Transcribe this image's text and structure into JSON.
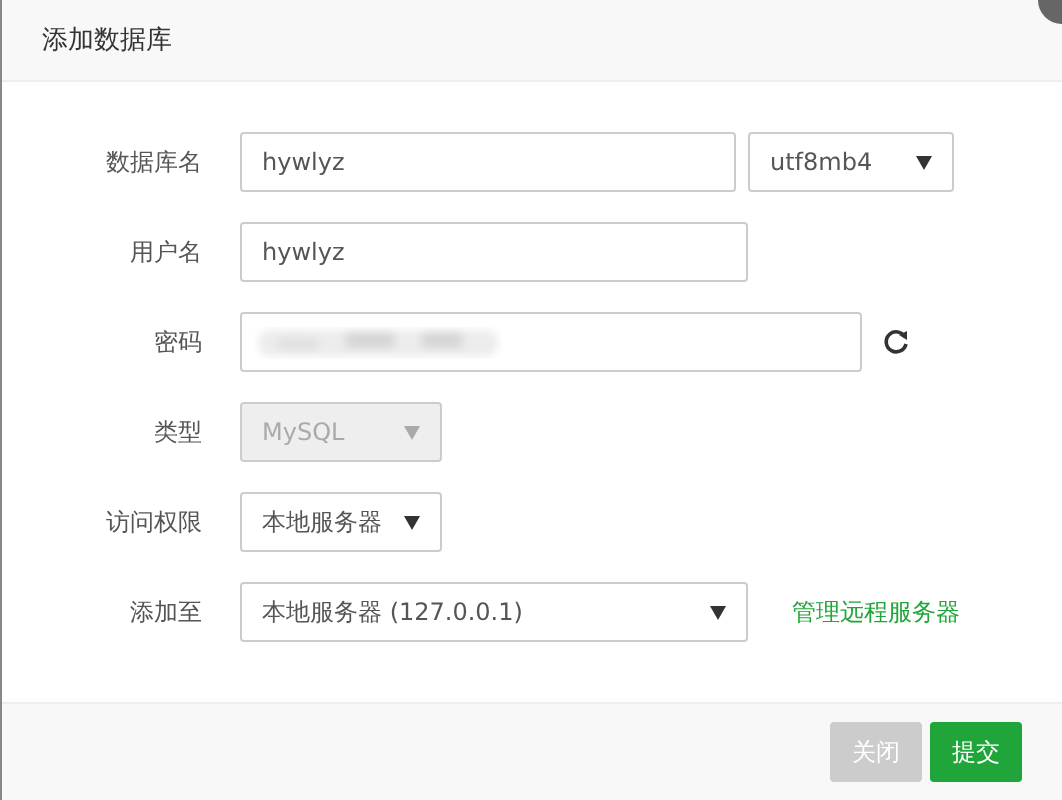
{
  "dialog": {
    "title": "添加数据库"
  },
  "rows": [
    {
      "label": "数据库名",
      "controls": [
        {
          "kind": "input",
          "value": "hywlyz"
        },
        {
          "kind": "select",
          "value": "utf8mb4",
          "disabled": false
        }
      ]
    },
    {
      "label": "用户名",
      "controls": [
        {
          "kind": "input",
          "value": "hywlyz"
        }
      ]
    },
    {
      "label": "密码",
      "controls": [
        {
          "kind": "password"
        },
        {
          "kind": "refresh"
        }
      ]
    },
    {
      "label": "类型",
      "controls": [
        {
          "kind": "select",
          "value": "MySQL",
          "disabled": true
        }
      ]
    },
    {
      "label": "访问权限",
      "controls": [
        {
          "kind": "select",
          "value": "本地服务器",
          "disabled": false
        }
      ]
    },
    {
      "label": "添加至",
      "controls": [
        {
          "kind": "select",
          "value": "本地服务器 (127.0.0.1)",
          "disabled": false
        },
        {
          "kind": "link",
          "text": "管理远程服务器"
        }
      ]
    }
  ],
  "buttons": [
    {
      "label": "关闭",
      "kind": "secondary"
    },
    {
      "label": "提交",
      "kind": "primary"
    }
  ]
}
